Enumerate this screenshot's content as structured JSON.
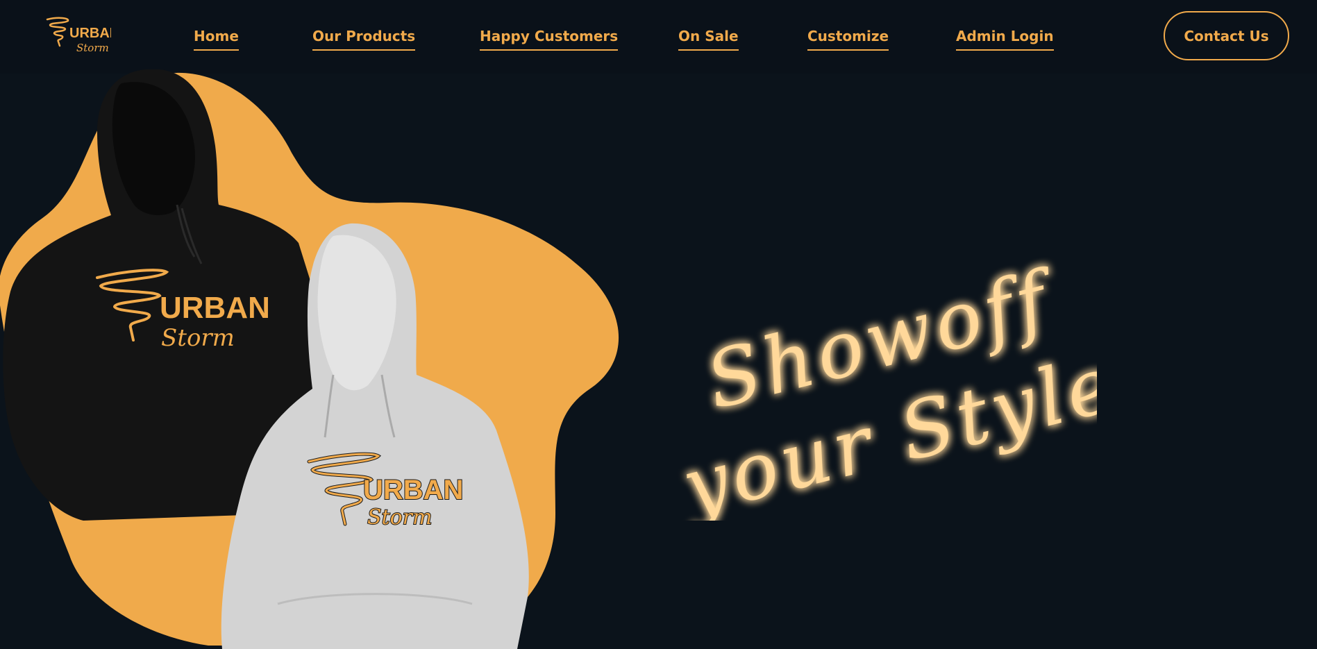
{
  "brand": {
    "logo_word": "URBAN",
    "logo_sub": "Storm"
  },
  "nav": {
    "items": [
      {
        "label": "Home"
      },
      {
        "label": "Our Products"
      },
      {
        "label": "Happy Customers"
      },
      {
        "label": "On Sale"
      },
      {
        "label": "Customize"
      },
      {
        "label": "Admin Login"
      }
    ],
    "contact_label": "Contact Us"
  },
  "hero": {
    "tagline_line1": "Showoff",
    "tagline_line2": "your Style",
    "hoodie_dark_print_word": "URBAN",
    "hoodie_dark_print_sub": "Storm",
    "hoodie_light_print_word": "URBAN",
    "hoodie_light_print_sub": "Storm"
  },
  "colors": {
    "background": "#0b131b",
    "accent": "#f1aa4b",
    "glow_text": "#ffd89a",
    "hoodie_dark": "#141414",
    "hoodie_light": "#d3d3d3"
  }
}
